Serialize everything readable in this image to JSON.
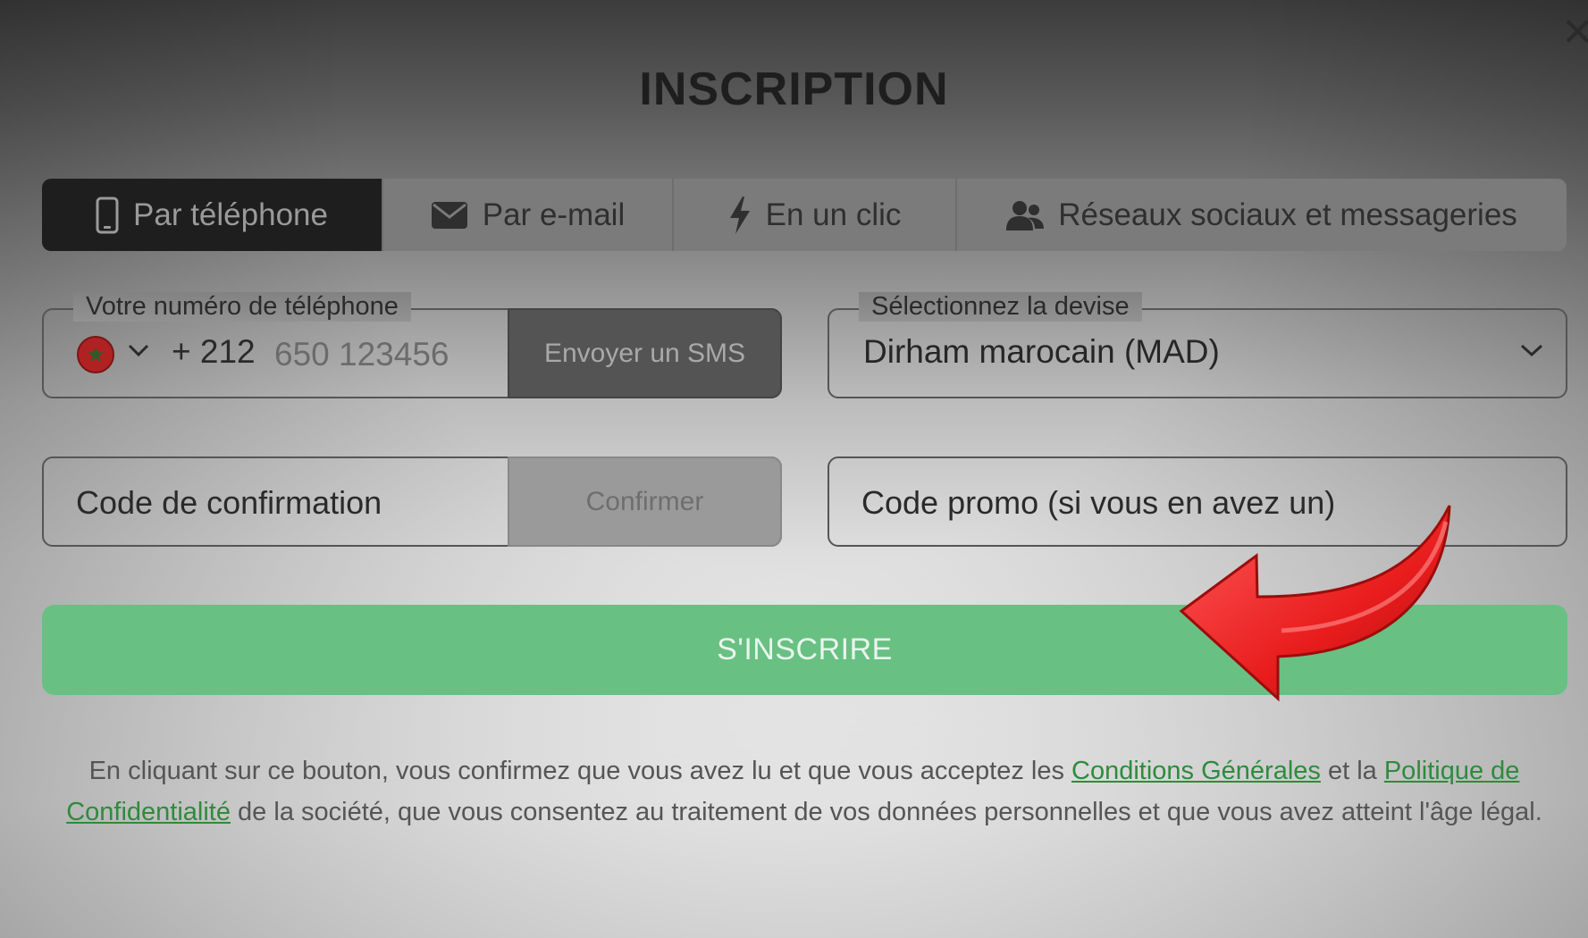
{
  "title": "INSCRIPTION",
  "close_label": "✕",
  "tabs": [
    {
      "label": "Par téléphone",
      "icon": "phone-icon",
      "active": true
    },
    {
      "label": "Par e-mail",
      "icon": "envelope-icon",
      "active": false
    },
    {
      "label": "En un clic",
      "icon": "lightning-icon",
      "active": false
    },
    {
      "label": "Réseaux sociaux et messageries",
      "icon": "people-icon",
      "active": false
    }
  ],
  "phone": {
    "legend": "Votre numéro de téléphone",
    "country_flag": "morocco-flag-icon",
    "dial_code": "+ 212",
    "placeholder": "650 123456",
    "send_sms_label": "Envoyer un SMS"
  },
  "currency": {
    "legend": "Sélectionnez la devise",
    "value": "Dirham marocain (MAD)"
  },
  "confirmation": {
    "placeholder": "Code de confirmation",
    "confirm_label": "Confirmer"
  },
  "promo": {
    "placeholder": "Code promo (si vous en avez un)"
  },
  "register_label": "S'INSCRIRE",
  "legal": {
    "text_1": "En cliquant sur ce bouton, vous confirmez que vous avez lu et que vous acceptez les ",
    "link_terms": "Conditions Générales",
    "text_2": " et la ",
    "link_privacy": "Politique de Confidentialité",
    "text_3": " de la société, que vous consentez au traitement de vos données personnelles et que vous avez atteint l'âge légal."
  },
  "colors": {
    "accent_green": "#68c083",
    "link_green": "#2e8b3c",
    "arrow_red": "#e82020"
  }
}
